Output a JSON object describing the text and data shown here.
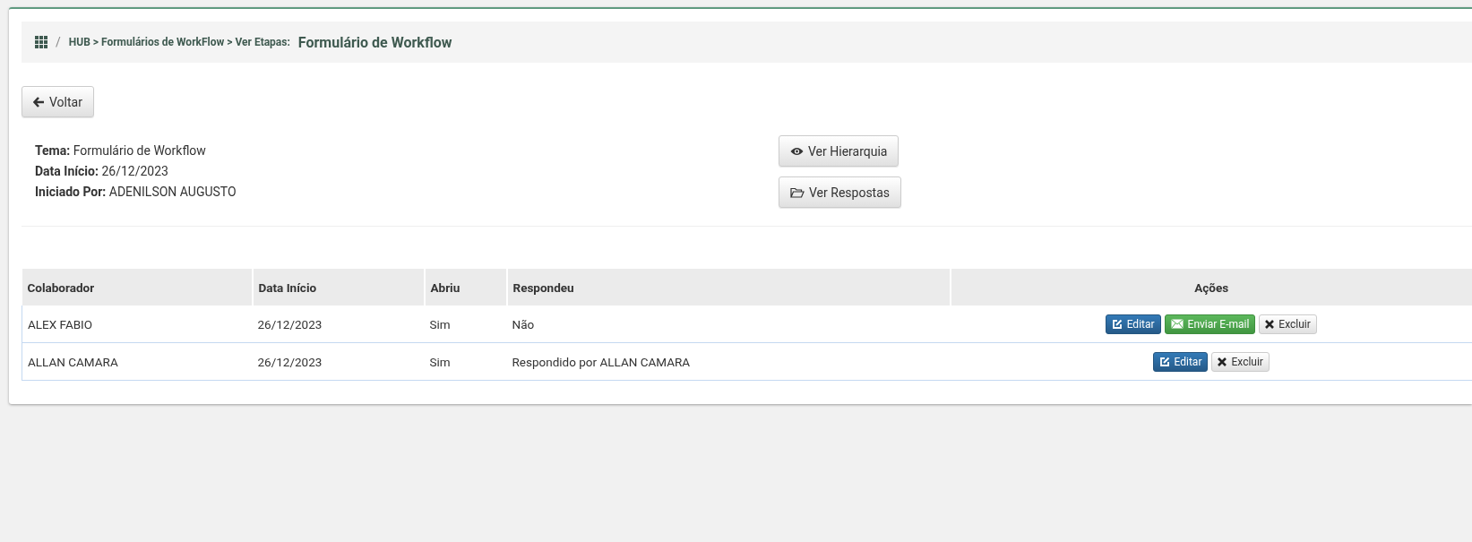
{
  "breadcrumb": {
    "separator": "/",
    "path": "HUB > Formulários de WorkFlow > Ver Etapas:",
    "title": "Formulário de Workflow"
  },
  "back_button": "Voltar",
  "details": [
    {
      "label": "Tema:",
      "value": "Formulário de Workflow"
    },
    {
      "label": "Data Início:",
      "value": "26/12/2023"
    },
    {
      "label": "Iniciado Por:",
      "value": "ADENILSON AUGUSTO"
    }
  ],
  "side_buttons": [
    {
      "kind": "eye",
      "label": "Ver Hierarquia"
    },
    {
      "kind": "folder",
      "label": "Ver Respostas"
    }
  ],
  "table": {
    "columns": [
      "Colaborador",
      "Data Início",
      "Abriu",
      "Respondeu",
      "Ações"
    ],
    "rows": [
      {
        "cells": [
          "ALEX FABIO",
          "26/12/2023",
          "Sim",
          "Não"
        ],
        "actions": [
          {
            "kind": "edit",
            "label": "Editar"
          },
          {
            "kind": "email",
            "label": "Enviar E-mail"
          },
          {
            "kind": "delete",
            "label": "Excluir"
          }
        ]
      },
      {
        "cells": [
          "ALLAN CAMARA",
          "26/12/2023",
          "Sim",
          "Respondido por ALLAN CAMARA"
        ],
        "actions": [
          {
            "kind": "edit",
            "label": "Editar"
          },
          {
            "kind": "delete",
            "label": "Excluir"
          }
        ]
      }
    ]
  }
}
